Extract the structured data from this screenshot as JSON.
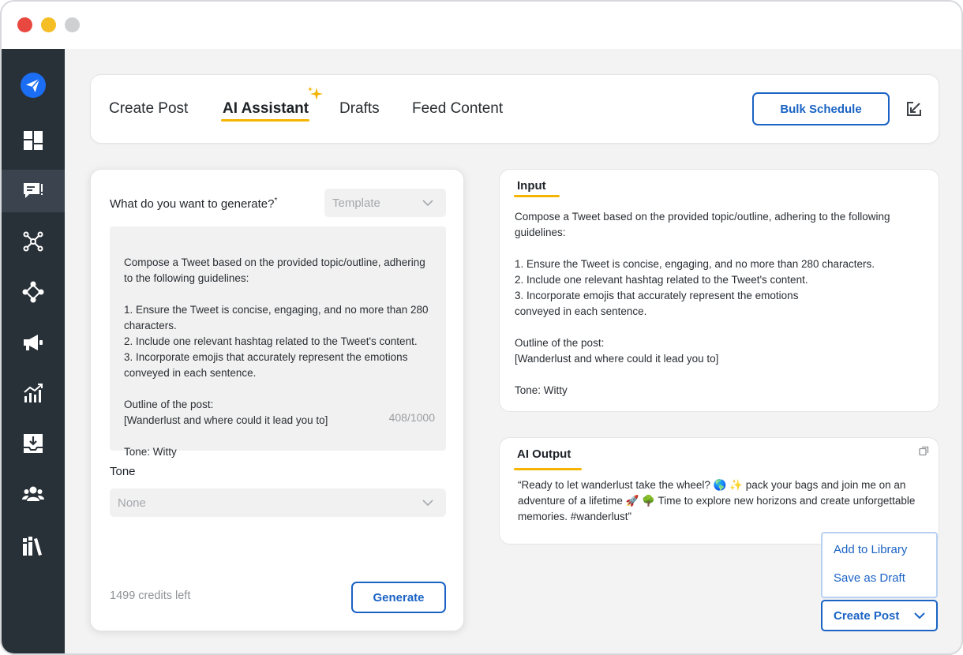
{
  "window": {
    "controls": [
      "close",
      "minimize",
      "maximize"
    ]
  },
  "sidebar": {
    "items": [
      {
        "icon": "paper-plane-logo-icon"
      },
      {
        "icon": "dashboard-grid-icon"
      },
      {
        "icon": "compose-message-icon",
        "active": true
      },
      {
        "icon": "network-hub-icon"
      },
      {
        "icon": "workflow-nodes-icon"
      },
      {
        "icon": "megaphone-icon"
      },
      {
        "icon": "analytics-chart-icon"
      },
      {
        "icon": "inbox-download-icon"
      },
      {
        "icon": "team-users-icon"
      },
      {
        "icon": "library-books-icon"
      }
    ]
  },
  "tabs": {
    "items": [
      {
        "label": "Create Post"
      },
      {
        "label": "AI Assistant",
        "active": true
      },
      {
        "label": "Drafts"
      },
      {
        "label": "Feed Content"
      }
    ],
    "bulk_schedule_label": "Bulk Schedule"
  },
  "generator": {
    "question_label": "What do you want to generate?",
    "required_mark": "*",
    "template_placeholder": "Template",
    "prompt_text": "Compose a Tweet based on the provided topic/outline, adhering to the following guidelines:\n\n1. Ensure the Tweet is concise, engaging, and no more than 280 characters.\n2. Include one relevant hashtag related to the Tweet's content.\n3. Incorporate emojis that accurately represent the emotions conveyed in each sentence.\n\nOutline of the post:\n[Wanderlust and where could it lead you to]\n\nTone: Witty",
    "char_counter": "408/1000",
    "tone_label": "Tone",
    "tone_value": "None",
    "credits_text": "1499 credits left",
    "generate_label": "Generate"
  },
  "input_panel": {
    "title": "Input",
    "text": "Compose a Tweet based on the provided topic/outline, adhering to the following guidelines:\n\n1. Ensure the Tweet is concise, engaging, and no more than 280 characters.\n2. Include one relevant hashtag related to the Tweet's content.\n3. Incorporate emojis that accurately represent the emotions\nconveyed in each sentence.\n\nOutline of the post:\n[Wanderlust and where could it lead you to]\n\nTone: Witty"
  },
  "output_panel": {
    "title": "AI Output",
    "text": "“Ready to let wanderlust take the wheel? 🌎 ✨ pack your bags and join me on an adventure of a lifetime 🚀 🌳 Time to explore new horizons and create unforgettable memories.  #wanderlust”"
  },
  "actions": {
    "menu": [
      {
        "label": "Add to Library"
      },
      {
        "label": "Save as Draft"
      }
    ],
    "create_post_label": "Create Post"
  },
  "colors": {
    "accent": "#1a63c4",
    "highlight": "#f5b400",
    "sidebar": "#283038"
  }
}
